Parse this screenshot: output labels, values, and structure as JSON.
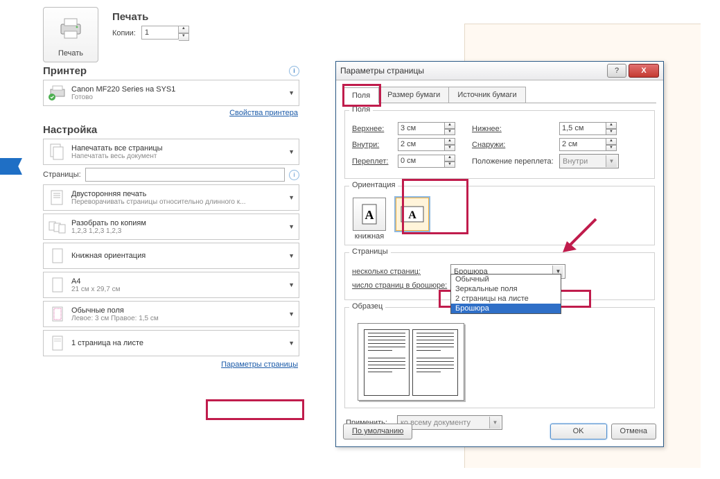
{
  "print": {
    "header": "Печать",
    "button": "Печать",
    "copies_label": "Копии:",
    "copies_value": "1"
  },
  "printer": {
    "section": "Принтер",
    "name": "Canon MF220 Series на SYS1",
    "status": "Готово",
    "properties_link": "Свойства принтера"
  },
  "settings": {
    "section": "Настройка",
    "print_all_t": "Напечатать все страницы",
    "print_all_s": "Напечатать весь документ",
    "pages_label": "Страницы:",
    "duplex_t": "Двусторонняя печать",
    "duplex_s": "Переворачивать страницы относительно длинного к...",
    "collate_t": "Разобрать по копиям",
    "collate_s": "1,2,3   1,2,3   1,2,3",
    "orient": "Книжная ориентация",
    "paper_t": "A4",
    "paper_s": "21 см x 29,7 см",
    "margins_t": "Обычные поля",
    "margins_s": "Левое: 3 см   Правое: 1,5 см",
    "per_sheet": "1 страница на листе",
    "page_setup_link": "Параметры страницы"
  },
  "dialog": {
    "title": "Параметры страницы",
    "tabs": {
      "margins": "Поля",
      "paper": "Размер бумаги",
      "source": "Источник бумаги"
    },
    "margins_group": "Поля",
    "top_l": "Верхнее:",
    "top_v": "3 см",
    "bottom_l": "Нижнее:",
    "bottom_v": "1,5 см",
    "inside_l": "Внутри:",
    "inside_v": "2 см",
    "outside_l": "Снаружи:",
    "outside_v": "2 см",
    "gutter_l": "Переплет:",
    "gutter_v": "0 см",
    "gutter_pos_l": "Положение переплета:",
    "gutter_pos_v": "Внутри",
    "orient_group": "Ориентация",
    "portrait": "книжная",
    "pages_group": "Страницы",
    "multi_l": "несколько страниц:",
    "multi_v": "Брошюра",
    "sheets_l": "число страниц в брошюре:",
    "dd_opts": [
      "Обычный",
      "Зеркальные поля",
      "2 страницы на листе",
      "Брошюра"
    ],
    "sample": "Образец",
    "apply_l": "Применить:",
    "apply_v": "ко всему документу",
    "default_btn": "По умолчанию",
    "ok": "OK",
    "cancel": "Отмена"
  }
}
